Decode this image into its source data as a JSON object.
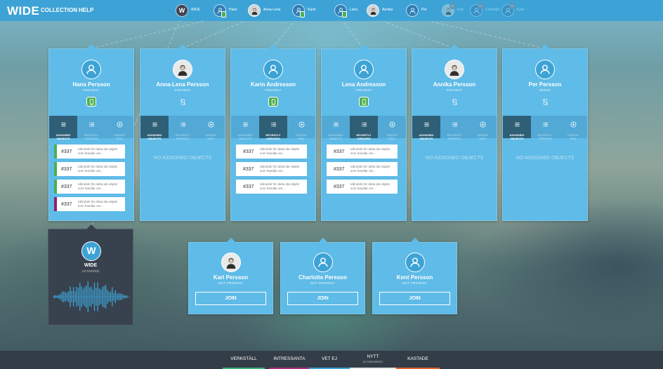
{
  "app": {
    "logo": "WIDE"
  },
  "nav": {
    "collection": "COLLECTION",
    "help": "HELP"
  },
  "presence": [
    {
      "name": "WIDE",
      "kind": "wide"
    },
    {
      "name": "Hans",
      "device": true
    },
    {
      "name": "Anna-Lena",
      "photo": true
    },
    {
      "name": "Karin",
      "device": true
    },
    {
      "name": "Lena",
      "device": true
    },
    {
      "name": "Annika",
      "photo": true
    },
    {
      "name": "Per"
    },
    {
      "name": "Karl",
      "photo": true,
      "faded": true,
      "count": "01"
    },
    {
      "name": "Charlotte",
      "faded": true,
      "count": "01"
    },
    {
      "name": "Kent",
      "faded": true,
      "count": "01"
    }
  ],
  "tabs": {
    "assigned": "ASSIGNED\nOBJECTS",
    "recent": "RECENTLY\nCREATED",
    "create": "CREATE\nNEW"
  },
  "item_text": "Idérubrik för detta ide-objekt som handlar om...",
  "no_assigned": "NO ASSIGNED OBJECTS",
  "cards": [
    {
      "name": "Hans Persson",
      "status": "PRESENT",
      "device": "on",
      "active_tab": "assigned",
      "items": [
        {
          "num": "#337",
          "color": "#4caf50"
        },
        {
          "num": "#337",
          "color": "#4caf50"
        },
        {
          "num": "#337",
          "color": "#4caf50"
        },
        {
          "num": "#337",
          "color": "#8e1f6e"
        }
      ]
    },
    {
      "name": "Anna-Lena Persson",
      "status": "PRESENT",
      "device": "off",
      "photo": true,
      "active_tab": "assigned",
      "items": []
    },
    {
      "name": "Karin Andresson",
      "status": "PRESENT",
      "device": "on",
      "active_tab": "recent",
      "items": [
        {
          "num": "#337"
        },
        {
          "num": "#337"
        },
        {
          "num": "#337"
        }
      ]
    },
    {
      "name": "Lena Andresson",
      "status": "PRESENT",
      "device": "on",
      "active_tab": "recent",
      "items": [
        {
          "num": "#337"
        },
        {
          "num": "#337"
        },
        {
          "num": "#337"
        }
      ]
    },
    {
      "name": "Annika Persson",
      "status": "PRESENT",
      "device": "off",
      "photo": true,
      "active_tab": "assigned",
      "items": []
    },
    {
      "name": "Per Persson",
      "status": "SERPE",
      "device": "off",
      "active_tab": "assigned",
      "items": []
    }
  ],
  "wide_panel": {
    "initial": "W",
    "name": "WIDE",
    "status": "ACTIVATED"
  },
  "join_cards": [
    {
      "name": "Karl Persson",
      "status": "NOT PRESENT",
      "photo": true,
      "button": "JOIN"
    },
    {
      "name": "Charlotte Persson",
      "status": "NOT PRESENT",
      "button": "JOIN"
    },
    {
      "name": "Kent Persson",
      "status": "NOT PRESENT",
      "button": "JOIN"
    }
  ],
  "categories": [
    {
      "label": "VERKSTÄLL",
      "color": "#3cb37a"
    },
    {
      "label": "INTRESSANTA",
      "color": "#b02e7f"
    },
    {
      "label": "VET EJ",
      "color": "#3da3d6"
    },
    {
      "label": "NYTT",
      "sub": "(EJ DEFINIERAT)",
      "color": "#e8e8e8"
    },
    {
      "label": "KASTADE",
      "color": "#e0632a"
    }
  ],
  "colors": {
    "accent": "#3da3d6",
    "card": "#5fbbe7",
    "tab_active": "#2e5f77",
    "dark_panel": "#38424e",
    "bottom_bar": "#333d48"
  }
}
